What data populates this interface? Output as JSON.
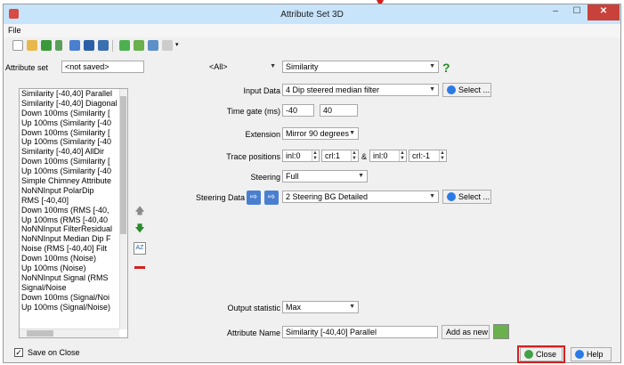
{
  "window": {
    "title": "Attribute Set 3D"
  },
  "menu": {
    "file": "File"
  },
  "attribute_set": {
    "label": "Attribute set",
    "value": "<not saved>"
  },
  "filter_combo": {
    "value": "<All>"
  },
  "attribute_type_combo": {
    "value": "Similarity"
  },
  "attribute_list": {
    "items": [
      "Similarity [-40,40] Parallel",
      "Similarity [-40,40] Diagonal",
      "Down 100ms (Similarity [",
      "Up 100ms (Similarity [-40",
      "Down 100ms (Similarity [",
      "Up 100ms (Similarity [-40",
      "Similarity [-40,40] AllDir",
      "Down 100ms (Similarity [",
      "Up 100ms (Similarity [-40",
      "Simple Chimney Attribute",
      "NoNNInput PolarDip",
      "RMS [-40,40]",
      "Down 100ms (RMS [-40,",
      "Up 100ms (RMS [-40,40",
      "NoNNInput FilterResidual",
      "NoNNInput Median Dip F",
      "Noise (RMS [-40,40] Filt",
      "Down 100ms (Noise)",
      "Up 100ms (Noise)",
      "NoNNInput Signal (RMS",
      "Signal/Noise",
      "Down 100ms (Signal/Noi",
      "Up 100ms (Signal/Noise)"
    ]
  },
  "form": {
    "input_data": {
      "label": "Input Data",
      "value": "4 Dip steered median filter",
      "select_label": "Select ..."
    },
    "time_gate": {
      "label": "Time gate (ms)",
      "start": "-40",
      "end": "40"
    },
    "extension": {
      "label": "Extension",
      "value": "Mirror 90 degrees"
    },
    "trace_positions": {
      "label": "Trace positions",
      "inl1": "inl:0",
      "crl1": "crl:1",
      "amp": "&",
      "inl2": "inl:0",
      "crl2": "crl:-1"
    },
    "steering": {
      "label": "Steering",
      "value": "Full"
    },
    "steering_data": {
      "label": "Steering Data",
      "value": "2 Steering BG Detailed",
      "select_label": "Select ..."
    },
    "output_statistic": {
      "label": "Output statistic",
      "value": "Max"
    },
    "attribute_name": {
      "label": "Attribute Name",
      "value": "Similarity [-40,40] Parallel",
      "add_label": "Add as new"
    }
  },
  "help_glyph": "?",
  "bottom": {
    "save_on_close": "Save on Close",
    "save_on_close_checked": true,
    "close_label": "Close",
    "help_label": "Help"
  },
  "colors": {
    "highlight": "#d42020",
    "titlebar": "#c8e4fb",
    "close_btn": "#c8423b"
  }
}
